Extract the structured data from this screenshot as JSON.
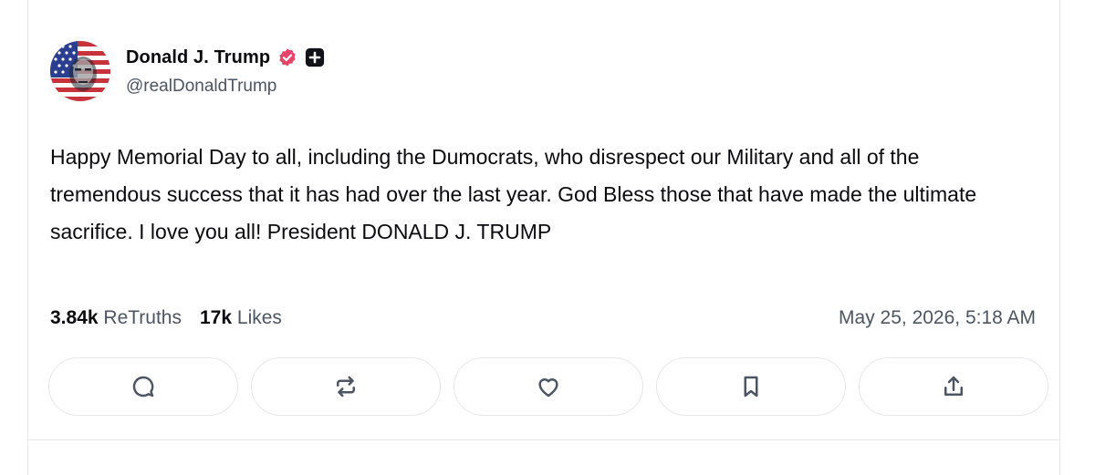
{
  "post": {
    "author": {
      "display_name": "Donald J. Trump",
      "handle": "@realDonaldTrump",
      "verified_icon": "verified-badge-icon",
      "extra_icon": "plus-badge-icon",
      "avatar": "flag-face-avatar"
    },
    "text": "Happy Memorial Day to all, including the Dumocrats, who disrespect our Military and all of the tremendous success that it has had over the last year. God Bless those that have made the ultimate sacrifice. I love you all! President DONALD J. TRUMP",
    "stats": {
      "retruths_count": "3.84k",
      "retruths_label": "ReTruths",
      "likes_count": "17k",
      "likes_label": "Likes"
    },
    "timestamp": "May 25, 2026, 5:18 AM"
  },
  "actions": [
    {
      "name": "reply",
      "icon": "comment-icon"
    },
    {
      "name": "retruth",
      "icon": "repost-icon"
    },
    {
      "name": "like",
      "icon": "heart-icon"
    },
    {
      "name": "bookmark",
      "icon": "bookmark-icon"
    },
    {
      "name": "share",
      "icon": "share-icon"
    }
  ],
  "colors": {
    "verified": "#e8446a",
    "text_primary": "#0b0b0f",
    "text_secondary": "#4b5563",
    "border": "#e5e7eb",
    "icon": "#4b5563"
  }
}
